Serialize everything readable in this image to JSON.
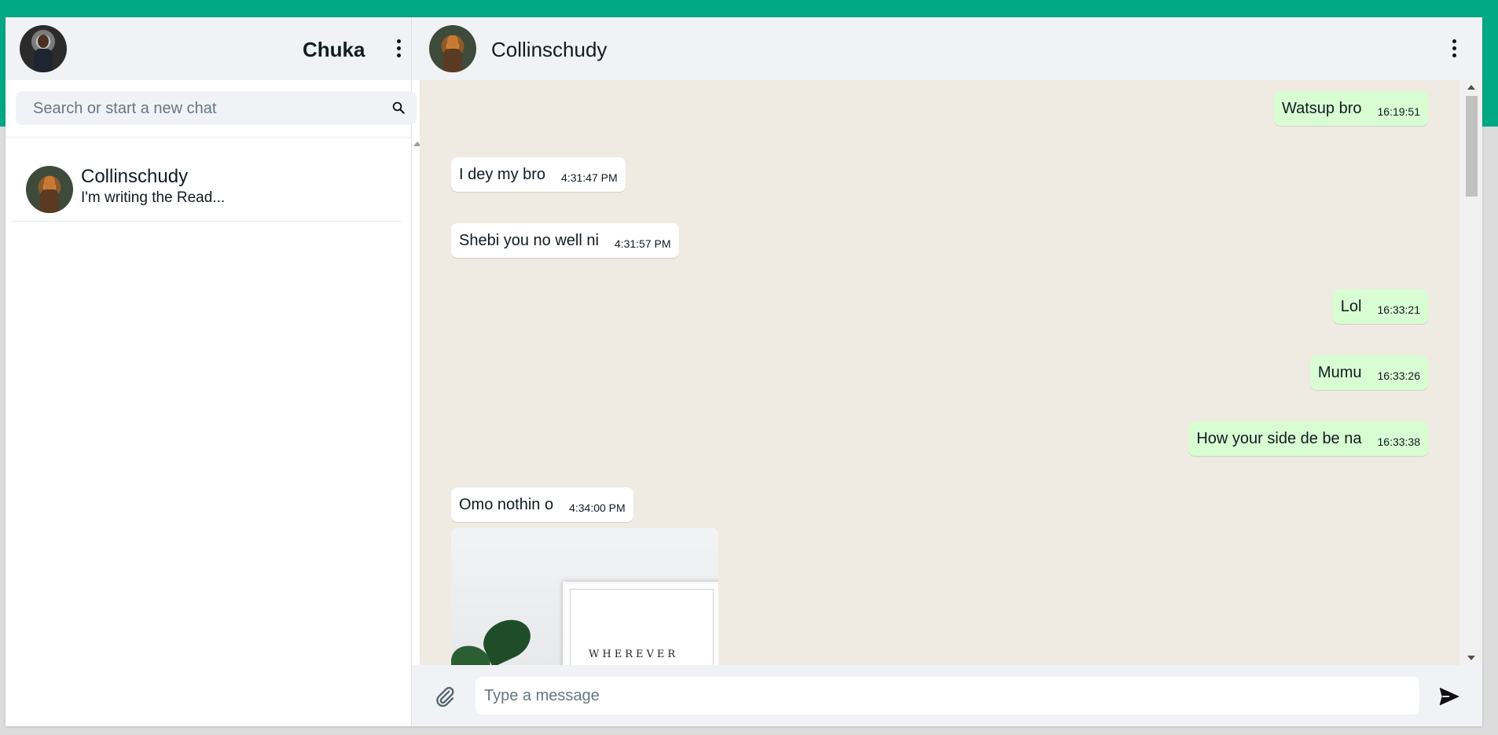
{
  "sidebar": {
    "user_name": "Chuka",
    "search_placeholder": "Search or start a new chat",
    "chats": [
      {
        "name": "Collinschudy",
        "preview": "I'm writing the Read..."
      }
    ]
  },
  "conversation": {
    "contact_name": "Collinschudy",
    "messages": [
      {
        "direction": "out",
        "text": "Watsup bro",
        "time": "16:19:51"
      },
      {
        "direction": "in",
        "text": "I dey my bro",
        "time": "4:31:47 PM"
      },
      {
        "direction": "in",
        "text": "Shebi you no well ni",
        "time": "4:31:57 PM"
      },
      {
        "direction": "out",
        "text": "Lol",
        "time": "16:33:21"
      },
      {
        "direction": "out",
        "text": "Mumu",
        "time": "16:33:26"
      },
      {
        "direction": "out",
        "text": "How your side de be na",
        "time": "16:33:38"
      },
      {
        "direction": "in",
        "text": "Omo nothin o",
        "time": "4:34:00 PM"
      }
    ],
    "image_message": {
      "frame_text": "WHEREVER"
    },
    "composer_placeholder": "Type a message"
  },
  "colors": {
    "accent": "#00a884",
    "header_bg": "#f0f2f5",
    "chat_bg": "#efeae2",
    "outgoing_bubble": "#d9fdd3",
    "incoming_bubble": "#ffffff"
  },
  "icons": [
    "avatar",
    "kebab-menu-icon",
    "search-icon",
    "attach-icon",
    "send-icon"
  ]
}
